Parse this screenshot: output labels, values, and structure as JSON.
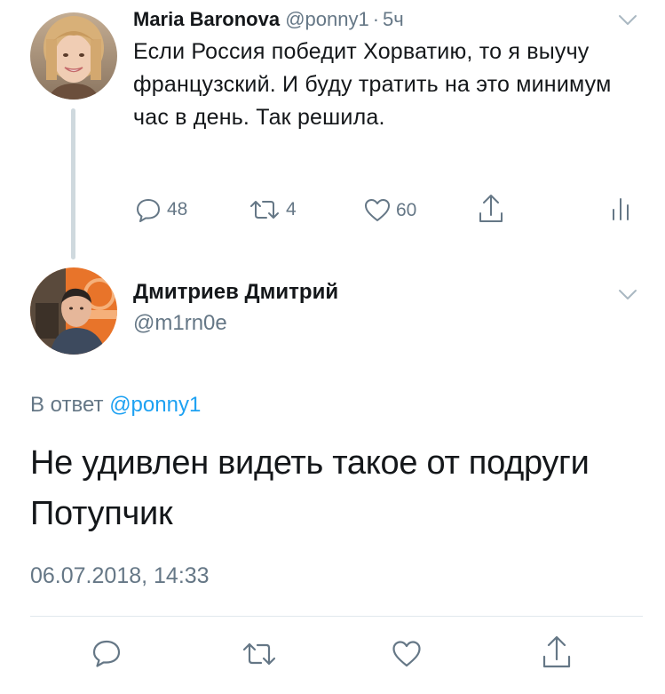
{
  "parent_tweet": {
    "display_name": "Maria Baronova",
    "handle": "@ponny1",
    "separator": "·",
    "time_ago": "5ч",
    "text": "Если Россия победит Хорватию, то я выучу французский. И буду тратить на это минимум час в день. Так решила.",
    "stats": {
      "replies": "48",
      "retweets": "4",
      "likes": "60"
    }
  },
  "main_tweet": {
    "display_name": "Дмитриев Дмитрий",
    "handle": "@m1rn0e",
    "reply_prefix": "В ответ",
    "reply_to_handle": "@ponny1",
    "text": "Не удивлен видеть такое от подруги Потупчик",
    "timestamp": "06.07.2018, 14:33"
  },
  "icons": {
    "reply": "reply-icon",
    "retweet": "retweet-icon",
    "like": "heart-icon",
    "share": "share-icon",
    "analytics": "analytics-icon",
    "menu": "chevron-down-icon"
  },
  "colors": {
    "link": "#1da1f2",
    "secondary_text": "#657786",
    "thread_line": "#cfd9de"
  }
}
